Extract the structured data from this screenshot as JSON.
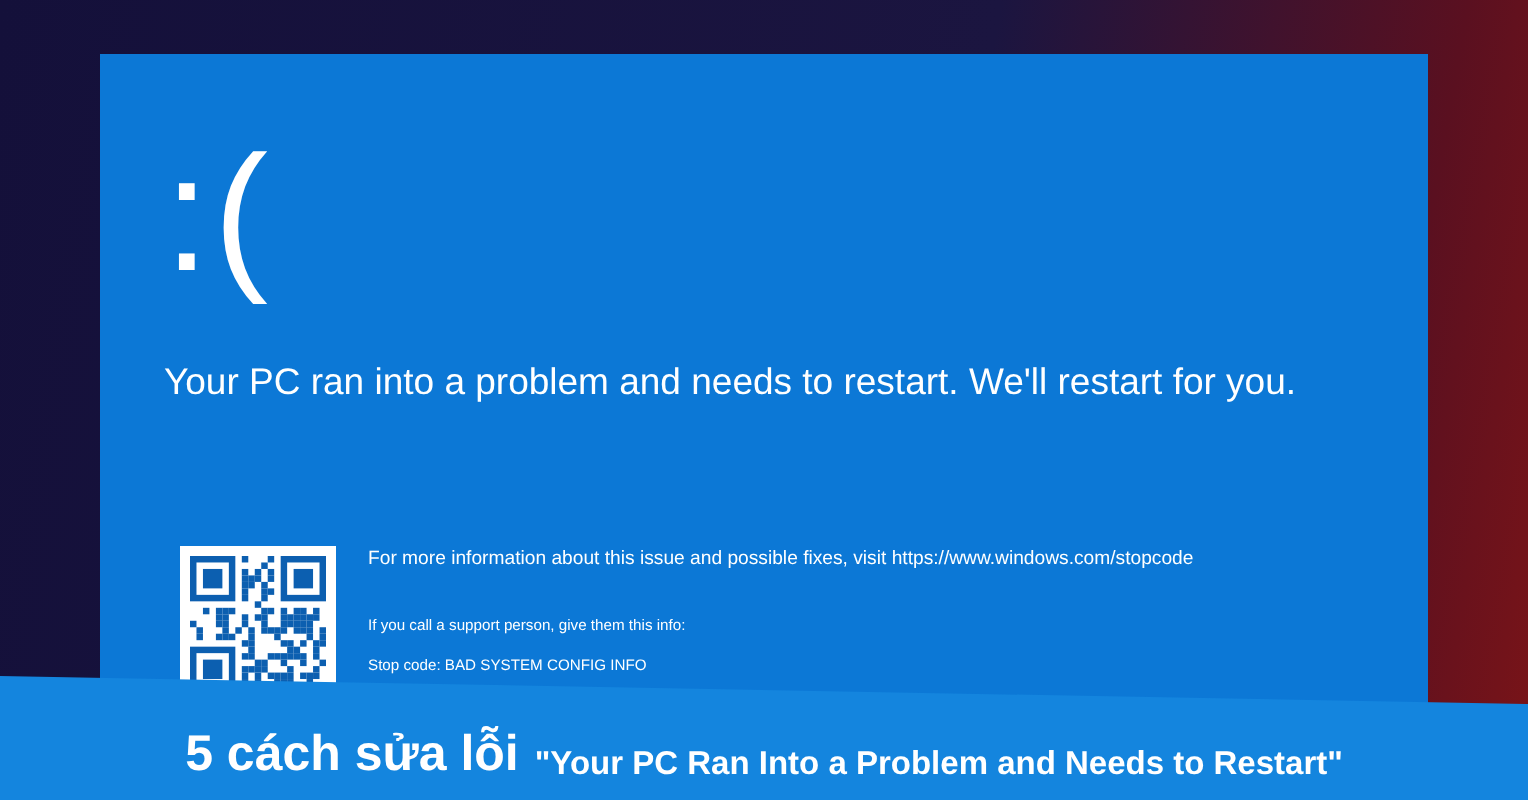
{
  "screen": {
    "face": ":(",
    "message": "Your PC ran into a problem and needs to restart. We'll restart for you.",
    "info_text": "For more information about this issue and possible fixes, visit https://www.windows.com/stopcode",
    "support_text": "If you call a support person, give them this info:",
    "stop_code": "Stop code: BAD SYSTEM CONFIG INFO"
  },
  "banner": {
    "headline": "5 cách sửa lỗi",
    "quote": "\"Your PC Ran Into a Problem and Needs to Restart\""
  }
}
